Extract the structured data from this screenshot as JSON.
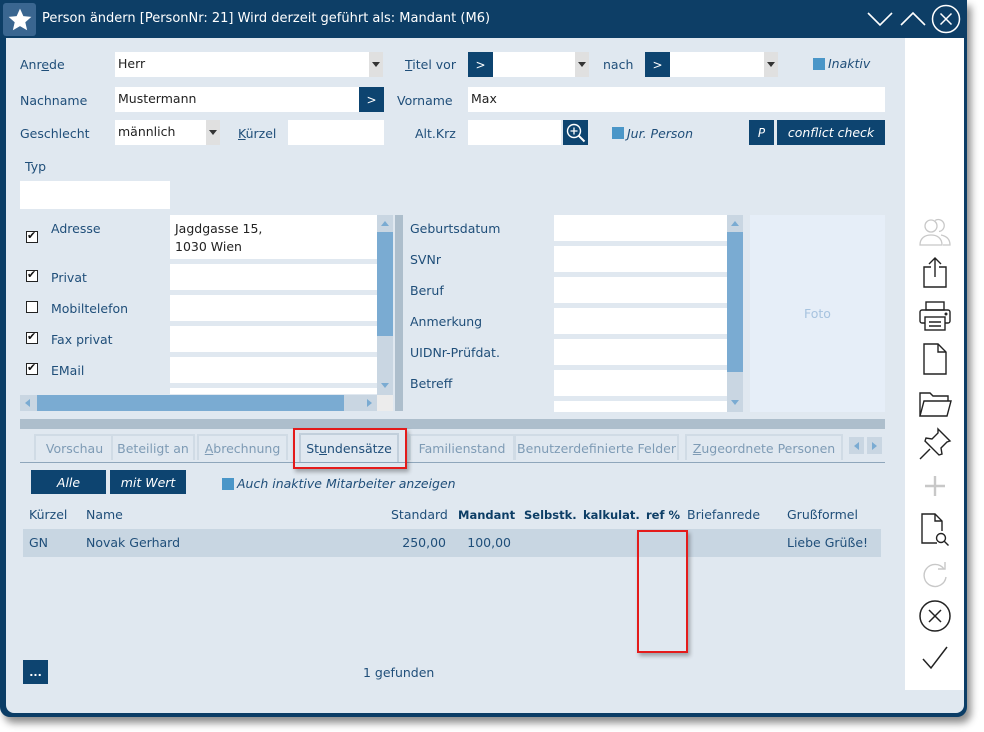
{
  "window": {
    "title": "Person ändern  [PersonNr: 21] Wird derzeit geführt als: Mandant (M6)",
    "controls": [
      "minimize-down",
      "maximize-up",
      "close"
    ]
  },
  "form": {
    "anrede_label_pre": "Anr",
    "anrede_label_ul": "e",
    "anrede_label_post": "de",
    "anrede_value": "Herr",
    "titel_vor_label_ul": "T",
    "titel_vor_label_post": "itel vor",
    "titel_vor_btn": ">",
    "titel_vor_value": "",
    "nach_label": "nach",
    "nach_btn": ">",
    "nach_value": "",
    "inaktiv_label": "Inaktiv",
    "nachname_label": "Nachname",
    "nachname_value": "Mustermann",
    "nachname_btn": ">",
    "vorname_label": "Vorname",
    "vorname_value": "Max",
    "geschlecht_label": "Geschlecht",
    "geschlecht_value": "männlich",
    "kuerzel_label_ul": "K",
    "kuerzel_label_post": "ürzel",
    "kuerzel_value": "",
    "altkrz_label": "Alt.Krz",
    "altkrz_value": "",
    "jur_person_label": "Jur. Person",
    "p_button": "P",
    "conflict_check_button": "conflict check",
    "typ_label": "Typ",
    "typ_value": ""
  },
  "contacts": [
    {
      "label": "Adresse",
      "checked": true,
      "value_line1": "Jagdgasse 15,",
      "value_line2": "1030 Wien"
    },
    {
      "label": "Privat",
      "checked": true,
      "value_line1": ""
    },
    {
      "label": "Mobiltelefon",
      "checked": false,
      "value_line1": ""
    },
    {
      "label": "Fax privat",
      "checked": true,
      "value_line1": ""
    },
    {
      "label": "EMail",
      "checked": true,
      "value_line1": ""
    }
  ],
  "details": [
    {
      "label": "Geburtsdatum",
      "value": ""
    },
    {
      "label": "SVNr",
      "value": ""
    },
    {
      "label": "Beruf",
      "value": ""
    },
    {
      "label": "Anmerkung",
      "value": ""
    },
    {
      "label": "UIDNr-Prüfdat.",
      "value": ""
    },
    {
      "label": "Betreff",
      "value": ""
    }
  ],
  "foto_label": "Foto",
  "tabs": [
    {
      "label": "Vorschau",
      "active": false
    },
    {
      "label": "Beteiligt an",
      "active": false
    },
    {
      "label_ul": "A",
      "label_post": "brechnung",
      "active": false
    },
    {
      "label_pre": "St",
      "label_ul": "u",
      "label_post": "ndensätze",
      "active": true
    },
    {
      "label": "Familienstand",
      "active": false
    },
    {
      "label": "Benutzerdefinierte Felder",
      "active": false
    },
    {
      "label_ul": "Z",
      "label_post": "ugeordnete Personen",
      "active": false
    }
  ],
  "stundensaetze": {
    "btn_alle": "Alle",
    "btn_mit_wert": "mit Wert",
    "inaktive_label": "Auch inaktive Mitarbeiter anzeigen",
    "columns": [
      "Kürzel",
      "Name",
      "Standard",
      "Mandant",
      "Selbstk.",
      "kalkulat.",
      "ref %",
      "Briefanrede",
      "Grußformel"
    ],
    "rows": [
      {
        "kuerzel": "GN",
        "name": "Novak Gerhard",
        "standard": "250,00",
        "mandant": "100,00",
        "selbstk": "",
        "kalkulat": "",
        "ref": "",
        "briefanrede": "",
        "grussformel": "Liebe Grüße!"
      }
    ],
    "more_button": "...",
    "found_text": "1 gefunden"
  },
  "sidebar_icons": [
    {
      "name": "users-icon",
      "enabled": false
    },
    {
      "name": "share-icon",
      "enabled": true
    },
    {
      "name": "printer-icon",
      "enabled": true
    },
    {
      "name": "document-icon",
      "enabled": true
    },
    {
      "name": "folder-icon",
      "enabled": true
    },
    {
      "name": "pin-icon",
      "enabled": true
    },
    {
      "name": "plus-icon",
      "enabled": false
    },
    {
      "name": "document-search-icon",
      "enabled": true
    },
    {
      "name": "refresh-icon",
      "enabled": false
    },
    {
      "name": "cancel-icon",
      "enabled": true
    },
    {
      "name": "confirm-icon",
      "enabled": true
    }
  ],
  "colors": {
    "title_bar": "#0d3e66",
    "client_bg": "#e0e8f0",
    "accent_button": "#0d4470",
    "checkbox_square": "#4a96c8",
    "scroll_thumb": "#7aabd2",
    "highlight_red": "#e41b1b",
    "row_selected": "#c8d6e2"
  }
}
